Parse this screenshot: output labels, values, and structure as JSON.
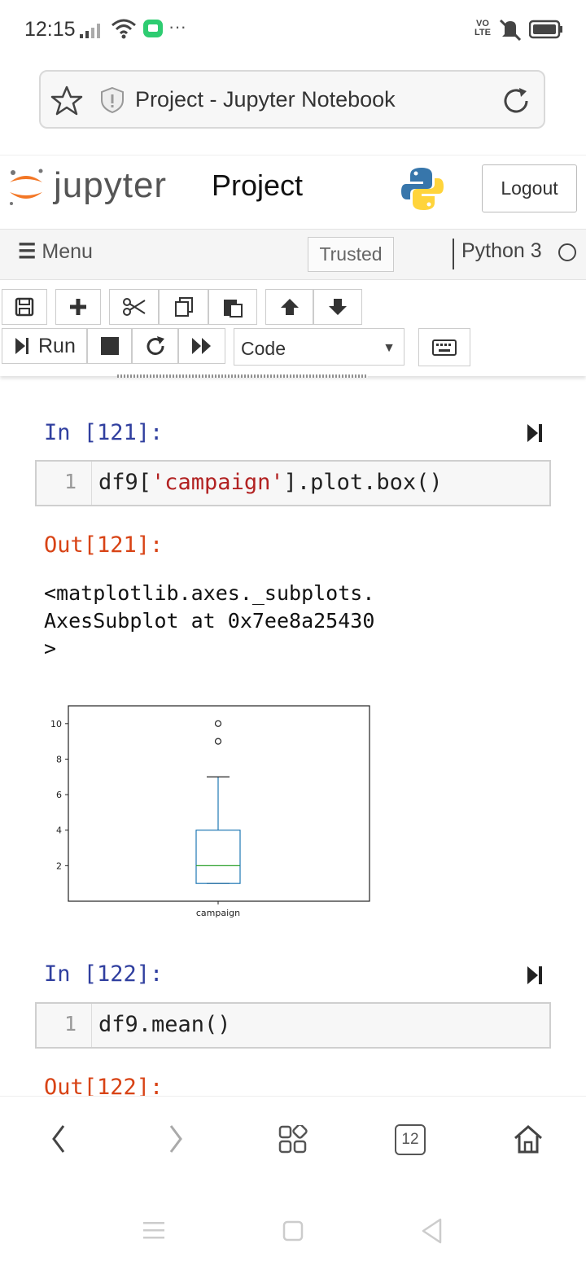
{
  "status_bar": {
    "time": "12:15",
    "network_label": "VO LTE",
    "icons": [
      "signal-icon",
      "wifi-icon",
      "chat-bubble-icon",
      "more-dots-icon",
      "mute-icon",
      "battery-icon"
    ]
  },
  "browser": {
    "page_title": "Project - Jupyter Notebook"
  },
  "header": {
    "brand": "jupyter",
    "notebook_name": "Project",
    "logout_label": "Logout"
  },
  "menubar": {
    "menu_label": "Menu",
    "trusted_label": "Trusted",
    "kernel_name": "Python 3"
  },
  "toolbar": {
    "run_label": "Run",
    "cell_type": "Code"
  },
  "cells": [
    {
      "in_prompt": "In [121]:",
      "line_number": "1",
      "code_pre": "df9[",
      "code_string": "'campaign'",
      "code_post": "].plot.box()",
      "out_prompt": "Out[121]:",
      "output_text": "<matplotlib.axes._subplots.AxesSubplot at 0x7ee8a25430>"
    },
    {
      "in_prompt": "In [122]:",
      "line_number": "1",
      "code": "df9.mean()",
      "out_prompt": "Out[122]:"
    }
  ],
  "chart_data": {
    "type": "box",
    "categories": [
      "campaign"
    ],
    "box": {
      "whisker_low": 1,
      "q1": 1,
      "median": 2,
      "q3": 4,
      "whisker_high": 7
    },
    "outliers": [
      9,
      10
    ],
    "yticks": [
      2,
      4,
      6,
      8,
      10
    ],
    "ylim": [
      0,
      11
    ],
    "box_color": "#1f77b4",
    "median_color": "#2ca02c"
  },
  "bottom_nav": {
    "tab_count": "12"
  }
}
